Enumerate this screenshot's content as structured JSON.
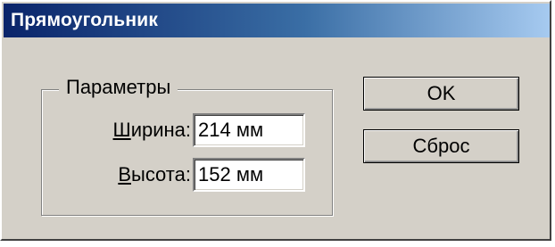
{
  "window": {
    "title": "Прямоугольник"
  },
  "parameters": {
    "group_label": "Параметры",
    "width_label_mnemonic": "Ш",
    "width_label_rest": "ирина:",
    "width_value": "214 мм",
    "height_label_mnemonic": "В",
    "height_label_rest": "ысота:",
    "height_value": "152 мм"
  },
  "buttons": {
    "ok_label": "OK",
    "reset_label": "Сброс"
  },
  "colors": {
    "dialog_bg": "#d4d0c8",
    "title_gradient_start": "#0a246a",
    "title_gradient_end": "#a6caf0"
  }
}
